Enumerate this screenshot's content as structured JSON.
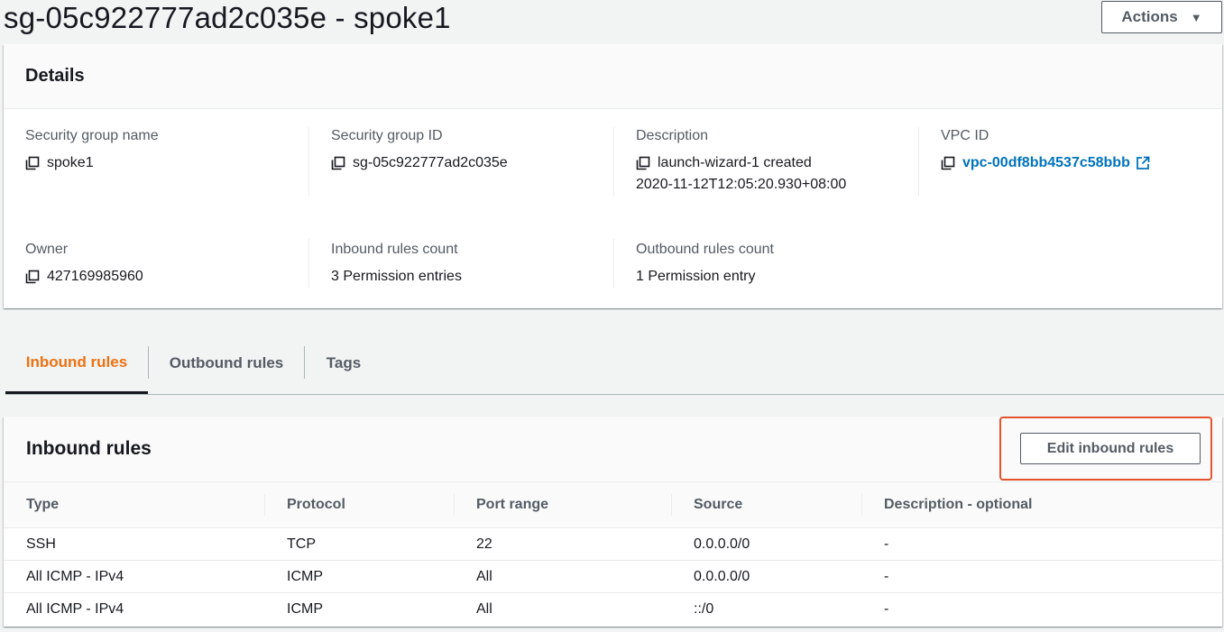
{
  "page": {
    "title": "sg-05c922777ad2c035e - spoke1",
    "actions_label": "Actions",
    "actions_caret": "▼"
  },
  "details": {
    "heading": "Details",
    "fields": {
      "sg_name": {
        "label": "Security group name",
        "value": "spoke1"
      },
      "sg_id": {
        "label": "Security group ID",
        "value": "sg-05c922777ad2c035e"
      },
      "description": {
        "label": "Description",
        "value_line1": "launch-wizard-1 created",
        "value_line2": "2020-11-12T12:05:20.930+08:00"
      },
      "vpc_id": {
        "label": "VPC ID",
        "value": "vpc-00df8bb4537c58bbb"
      },
      "owner": {
        "label": "Owner",
        "value": "427169985960"
      },
      "inbound_count": {
        "label": "Inbound rules count",
        "value": "3 Permission entries"
      },
      "outbound_count": {
        "label": "Outbound rules count",
        "value": "1 Permission entry"
      }
    }
  },
  "tabs": [
    {
      "label": "Inbound rules",
      "active": true
    },
    {
      "label": "Outbound rules",
      "active": false
    },
    {
      "label": "Tags",
      "active": false
    }
  ],
  "inbound": {
    "heading": "Inbound rules",
    "edit_label": "Edit inbound rules",
    "highlight_color": "#e5532e",
    "columns": [
      "Type",
      "Protocol",
      "Port range",
      "Source",
      "Description - optional"
    ],
    "rows": [
      [
        "SSH",
        "TCP",
        "22",
        "0.0.0.0/0",
        "-"
      ],
      [
        "All ICMP - IPv4",
        "ICMP",
        "All",
        "0.0.0.0/0",
        "-"
      ],
      [
        "All ICMP - IPv4",
        "ICMP",
        "All",
        "::/0",
        "-"
      ]
    ]
  },
  "colors": {
    "accent_orange": "#ec7211",
    "link_blue": "#0073bb"
  }
}
